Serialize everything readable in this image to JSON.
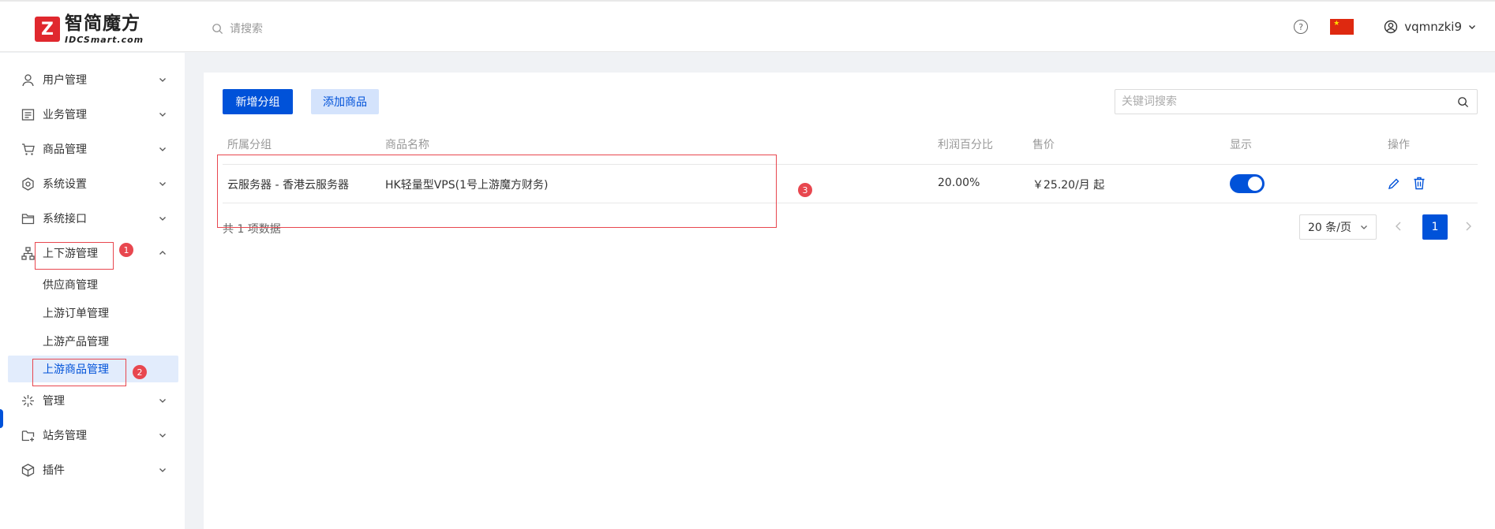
{
  "brand": {
    "name_cn": "智简魔方",
    "name_en": "IDCSmart.com",
    "mark": "Z"
  },
  "header": {
    "search_placeholder": "请搜索",
    "username": "vqmnzki9"
  },
  "sidebar": {
    "items": [
      {
        "label": "用户管理",
        "icon": "user-icon"
      },
      {
        "label": "业务管理",
        "icon": "business-icon"
      },
      {
        "label": "商品管理",
        "icon": "cart-icon"
      },
      {
        "label": "系统设置",
        "icon": "settings-icon"
      },
      {
        "label": "系统接口",
        "icon": "folder-icon"
      },
      {
        "label": "上下游管理",
        "icon": "network-icon"
      },
      {
        "label": "管理",
        "icon": "sparkle-icon"
      },
      {
        "label": "站务管理",
        "icon": "folder-plus-icon"
      },
      {
        "label": "插件",
        "icon": "cube-icon"
      }
    ],
    "sub_items": [
      {
        "label": "供应商管理"
      },
      {
        "label": "上游订单管理"
      },
      {
        "label": "上游产品管理"
      },
      {
        "label": "上游商品管理"
      }
    ]
  },
  "annotations": {
    "badge1": "1",
    "badge2": "2",
    "badge3": "3"
  },
  "toolbar": {
    "add_group": "新增分组",
    "add_product": "添加商品",
    "search_placeholder": "关键词搜索"
  },
  "table": {
    "columns": [
      "所属分组",
      "商品名称",
      "利润百分比",
      "售价",
      "显示",
      "操作"
    ],
    "rows": [
      {
        "group": "云服务器 - 香港云服务器",
        "name": "HK轻量型VPS(1号上游魔方财务)",
        "profit": "20.00%",
        "price": "￥25.20/月 起",
        "show": true
      }
    ]
  },
  "pagination": {
    "total_text": "共 1 项数据",
    "page_size": "20 条/页",
    "current_page": "1"
  },
  "colors": {
    "primary": "#0052d9",
    "annotation": "#e8474f",
    "brand": "#e0282e"
  }
}
